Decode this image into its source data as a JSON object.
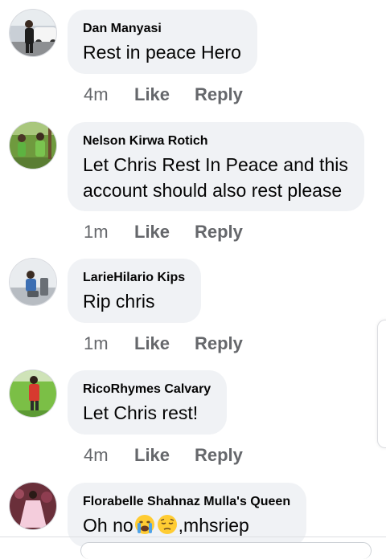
{
  "comments": [
    {
      "author": "Dan Manyasi",
      "text": "Rest in peace Hero",
      "time": "4m",
      "like_label": "Like",
      "reply_label": "Reply",
      "avatar_icon": "avatar-photo-man-standing-by-car"
    },
    {
      "author": "Nelson Kirwa Rotich",
      "text_line1": "Let Chris Rest In Peace and this",
      "text_line2": "account should also rest please",
      "time": "1m",
      "like_label": "Like",
      "reply_label": "Reply",
      "avatar_icon": "avatar-photo-people-outdoors-green"
    },
    {
      "author": "LarieHilario Kips",
      "text": "Rip chris",
      "time": "1m",
      "like_label": "Like",
      "reply_label": "Reply",
      "avatar_icon": "avatar-photo-person-seated"
    },
    {
      "author": "RicoRhymes Calvary",
      "text": "Let Chris rest!",
      "time": "4m",
      "like_label": "Like",
      "reply_label": "Reply",
      "avatar_icon": "avatar-photo-person-on-grass"
    },
    {
      "author": "Florabelle Shahnaz Mulla's Queen",
      "text_prefix": "Oh no",
      "text_suffix": ",mhsriep",
      "emojis": [
        "loudly-crying-face-emoji",
        "pensive-face-emoji"
      ],
      "avatar_icon": "avatar-photo-woman-pink-dress"
    }
  ],
  "colors": {
    "bubble": "#f0f2f5",
    "name_text": "#050505",
    "meta_text": "#65676b"
  }
}
